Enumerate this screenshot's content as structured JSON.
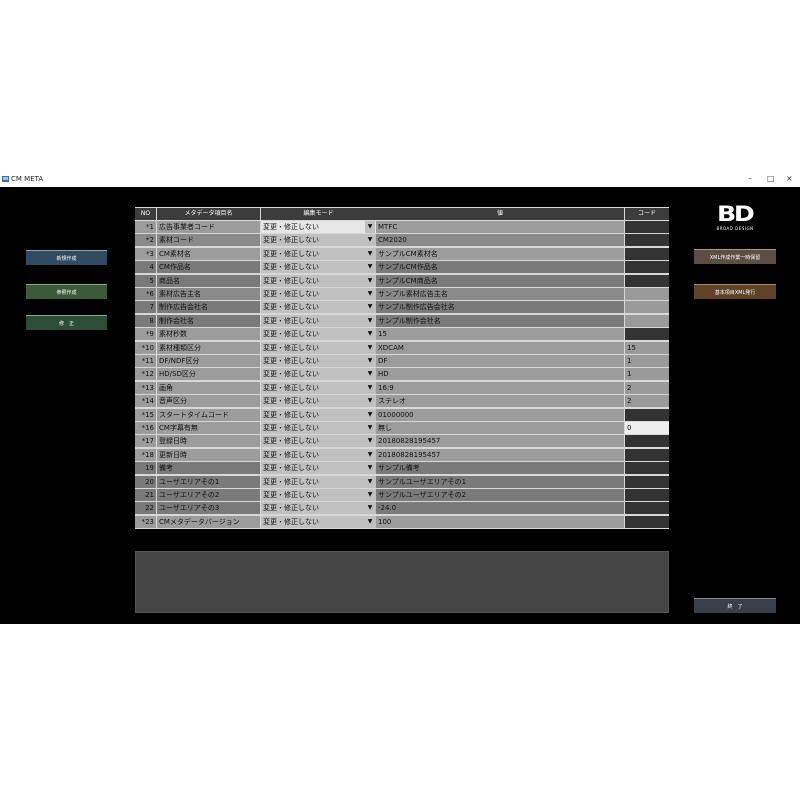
{
  "window": {
    "title": "CM META",
    "minimize": "–",
    "maximize": "□",
    "close": "×"
  },
  "left_buttons": {
    "new": "新規作成",
    "reference": "参照作成",
    "edit": "修　正"
  },
  "right_buttons": {
    "xml_batch": "XML作成作業一時保留",
    "xml_release": "基本項目XML発行",
    "exit": "終　了"
  },
  "logo": {
    "mark": "BD",
    "sub": "BROAD.DESIGN"
  },
  "table": {
    "headers": {
      "no": "NO",
      "name": "メタデータ項目名",
      "mode": "編集モード",
      "value": "値",
      "code": "コード"
    },
    "rows": [
      {
        "no": "*1",
        "name": "広告事業者コード",
        "mode": "変更・修正しない",
        "value": "MTFC",
        "code": ""
      },
      {
        "no": "*2",
        "name": "素材コード",
        "mode": "変更・修正しない",
        "value": "CM2020",
        "code": ""
      },
      {
        "no": "*3",
        "name": "CM素材名",
        "mode": "変更・修正しない",
        "value": "サンプルCM素材名",
        "code": ""
      },
      {
        "no": "4",
        "name": "CM作品名",
        "mode": "変更・修正しない",
        "value": "サンプルCM作品名",
        "code": ""
      },
      {
        "no": "5",
        "name": "商品名",
        "mode": "変更・修正しない",
        "value": "サンプルCM商品名",
        "code": ""
      },
      {
        "no": "*6",
        "name": "素材広告主名",
        "mode": "変更・修正しない",
        "value": "サンプル素材広告主名",
        "code": ""
      },
      {
        "no": "7",
        "name": "制作広告会社名",
        "mode": "変更・修正しない",
        "value": "サンプル制作広告会社名",
        "code": ""
      },
      {
        "no": "8",
        "name": "制作会社名",
        "mode": "変更・修正しない",
        "value": "サンプル制作会社名",
        "code": ""
      },
      {
        "no": "*9",
        "name": "素材秒数",
        "mode": "変更・修正しない",
        "value": "15",
        "code": ""
      },
      {
        "no": "*10",
        "name": "素材種類区分",
        "mode": "変更・修正しない",
        "value": "XDCAM",
        "code": "15"
      },
      {
        "no": "*11",
        "name": "DF/NDF区分",
        "mode": "変更・修正しない",
        "value": "DF",
        "code": "1"
      },
      {
        "no": "*12",
        "name": "HD/SD区分",
        "mode": "変更・修正しない",
        "value": "HD",
        "code": "1"
      },
      {
        "no": "*13",
        "name": "画角",
        "mode": "変更・修正しない",
        "value": "16:9",
        "code": "2"
      },
      {
        "no": "*14",
        "name": "音声区分",
        "mode": "変更・修正しない",
        "value": "ステレオ",
        "code": "2"
      },
      {
        "no": "*15",
        "name": "スタートタイムコード",
        "mode": "変更・修正しない",
        "value": "01000000",
        "code": ""
      },
      {
        "no": "*16",
        "name": "CM字幕有無",
        "mode": "変更・修正しない",
        "value": "無し",
        "code": "0"
      },
      {
        "no": "*17",
        "name": "登録日時",
        "mode": "変更・修正しない",
        "value": "20180828195457",
        "code": ""
      },
      {
        "no": "*18",
        "name": "更新日時",
        "mode": "変更・修正しない",
        "value": "20180828195457",
        "code": ""
      },
      {
        "no": "19",
        "name": "備考",
        "mode": "変更・修正しない",
        "value": "サンプル備考",
        "code": ""
      },
      {
        "no": "20",
        "name": "ユーザエリアその1",
        "mode": "変更・修正しない",
        "value": "サンプルユーザエリアその1",
        "code": ""
      },
      {
        "no": "21",
        "name": "ユーザエリアその2",
        "mode": "変更・修正しない",
        "value": "サンプルユーザエリアその2",
        "code": ""
      },
      {
        "no": "22",
        "name": "ユーザエリアその3",
        "mode": "変更・修正しない",
        "value": "-24.0",
        "code": ""
      },
      {
        "no": "*23",
        "name": "CMメタデータバージョン",
        "mode": "変更・修正しない",
        "value": "100",
        "code": ""
      }
    ]
  },
  "dropdown_arrow": "▼",
  "colors": {
    "app_background": "#000000",
    "header_background": "#3c3c3c",
    "new_button": "#2f4a61",
    "reference_button": "#3a5a3a",
    "edit_button": "#2d4e36",
    "xml_batch_button": "#5c4d45",
    "xml_release_button": "#5f4228",
    "exit_button": "#38404a"
  }
}
